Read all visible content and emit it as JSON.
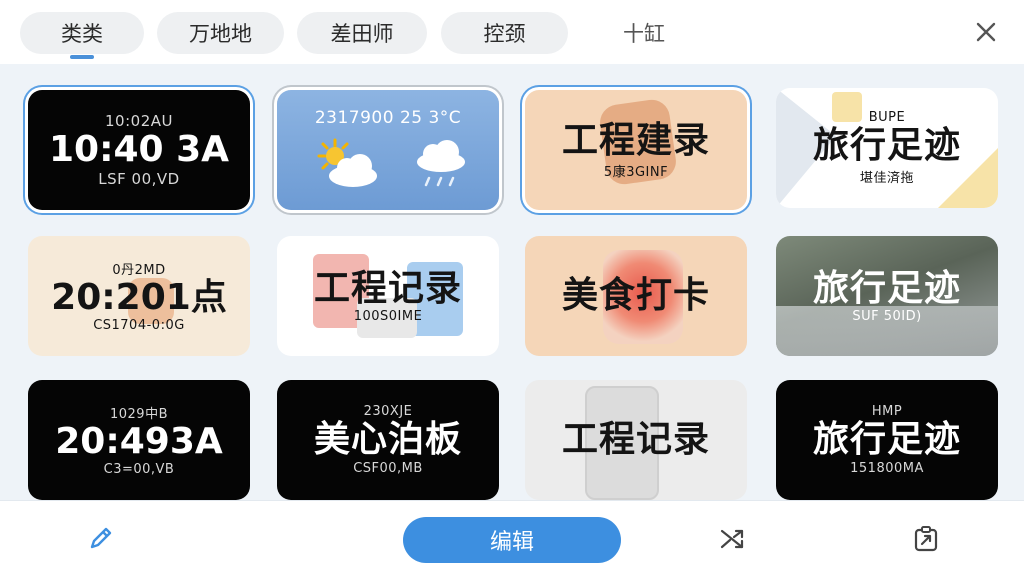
{
  "tabs": [
    {
      "label": "类类"
    },
    {
      "label": "万地地"
    },
    {
      "label": "差田师"
    },
    {
      "label": "控颈"
    },
    {
      "label": "十缸"
    }
  ],
  "cards": [
    {
      "top": "10:02AU",
      "main": "10:40 3A",
      "bottom": "LSF 00,VD"
    },
    {
      "top": "2317900 25 3°C",
      "weather_icons": [
        "sun-cloud-icon",
        "rain-cloud-icon"
      ]
    },
    {
      "main": "工程建录",
      "bottom": "5康3GINF"
    },
    {
      "top": "BUPE",
      "main": "旅行足迹",
      "bottom": "堪佳済拖"
    },
    {
      "top": "0丹2MD",
      "main": "20:201点",
      "bottom": "CS1704-0:0G"
    },
    {
      "main": "工程记录",
      "bottom": "100S0IME"
    },
    {
      "main": "美食打卡"
    },
    {
      "main": "旅行足迹",
      "bottom": "SUF 50ID)"
    },
    {
      "top": "1029中B",
      "main": "20:493A",
      "bottom": "C3=00,VB"
    },
    {
      "top": "230XJE",
      "main": "美心泊板",
      "bottom": "CSF00,MB"
    },
    {
      "main": "工程记录"
    },
    {
      "top": "HMP",
      "main": "旅行足迹",
      "bottom": "151800MA"
    }
  ],
  "toolbar": {
    "edit_label": "编辑",
    "icons": [
      "pencil-icon",
      "shuffle-icon",
      "share-icon"
    ]
  },
  "colors": {
    "accent": "#3d8fe0",
    "selection_ring": "#5ba0e4",
    "grid_background": "#eef3f8"
  }
}
